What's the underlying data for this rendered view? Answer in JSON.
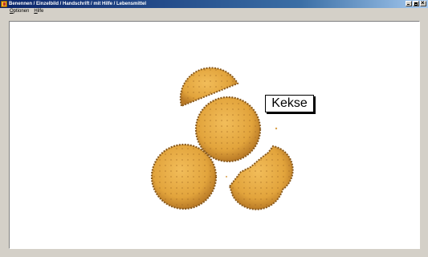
{
  "window": {
    "title": "Benennen / Einzelbild / Handschrift / mit Hilfe / Lebensmittel",
    "icon": "app-icon"
  },
  "menu": {
    "items": [
      {
        "label": "Optionen"
      },
      {
        "label": "Hilfe"
      }
    ]
  },
  "content": {
    "word_label": "Kekse",
    "image_subject": "cookies-icon"
  },
  "colors": {
    "title_bar_start": "#0a246a",
    "title_bar_end": "#a6caf0",
    "window_bg": "#d4d0c8",
    "canvas_bg": "#ffffff",
    "cookie_fill": "#e2a43c",
    "cookie_edge": "#8a5a1c"
  }
}
